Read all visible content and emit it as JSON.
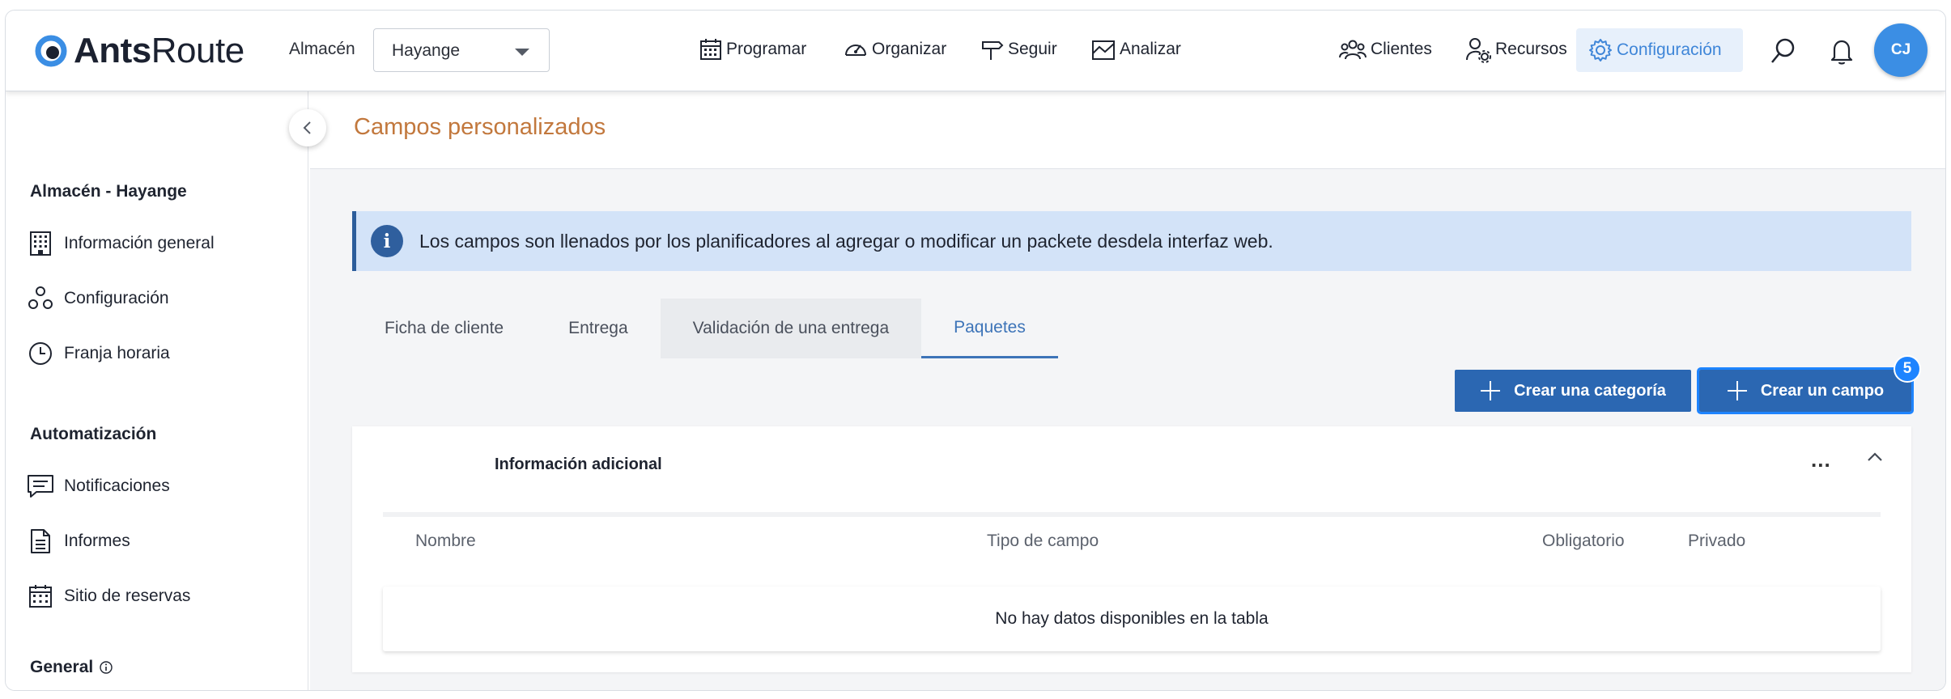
{
  "app": {
    "brand_bold": "Ants",
    "brand_light": "Route",
    "brand_color": "#3b8ee4"
  },
  "header": {
    "warehouse_label": "Almacén",
    "warehouse_value": "Hayange",
    "nav": [
      {
        "label": "Programar",
        "icon": "calendar-icon"
      },
      {
        "label": "Organizar",
        "icon": "speedometer-icon"
      },
      {
        "label": "Seguir",
        "icon": "signpost-icon"
      },
      {
        "label": "Analizar",
        "icon": "chart-icon"
      }
    ],
    "right_nav": [
      {
        "label": "Clientes",
        "icon": "users-icon"
      },
      {
        "label": "Recursos",
        "icon": "user-gear-icon"
      },
      {
        "label": "Configuración",
        "icon": "gear-icon",
        "active": true
      }
    ],
    "avatar_initials": "CJ"
  },
  "sidebar": {
    "section1_title": "Almacén - Hayange",
    "section1_items": [
      {
        "label": "Información general",
        "icon": "building-icon"
      },
      {
        "label": "Configuración",
        "icon": "nodes-icon"
      },
      {
        "label": "Franja horaria",
        "icon": "clock-icon"
      }
    ],
    "section2_title": "Automatización",
    "section2_items": [
      {
        "label": "Notificaciones",
        "icon": "message-icon"
      },
      {
        "label": "Informes",
        "icon": "document-icon"
      },
      {
        "label": "Sitio de reservas",
        "icon": "calendar-grid-icon"
      }
    ],
    "section3_title": "General"
  },
  "main": {
    "page_title": "Campos personalizados",
    "page_title_color": "#c2783d",
    "info_text": "Los campos son llenados por los planificadores al agregar o modificar un packete desdela interfaz web.",
    "tabs": [
      {
        "label": "Ficha de cliente"
      },
      {
        "label": "Entrega"
      },
      {
        "label": "Validación de una entrega"
      },
      {
        "label": "Paquetes",
        "active": true
      }
    ],
    "buttons": {
      "create_category": "Crear una categoría",
      "create_field": "Crear un campo",
      "create_field_badge": "5"
    },
    "card": {
      "title": "Información adicional",
      "more": "...",
      "columns": [
        "Nombre",
        "Tipo de campo",
        "Obligatorio",
        "Privado"
      ],
      "empty_message": "No hay datos disponibles en la tabla"
    }
  }
}
